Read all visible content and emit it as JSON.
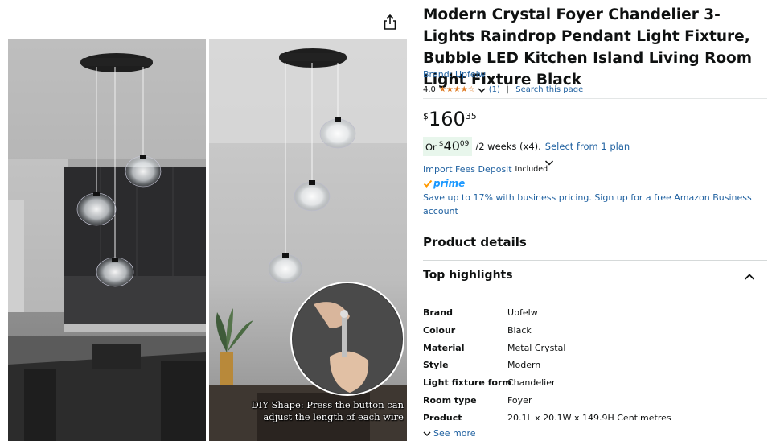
{
  "product": {
    "title": "Modern Crystal Foyer Chandelier 3-Lights Raindrop Pendant Light Fixture, Bubble LED Kitchen Island Living Room Light Fixture Black",
    "brand_link": "Brand: Upfelw",
    "rating_value": "4.0",
    "rating_stars": 4,
    "stars_display": "★★★★☆",
    "rating_count": "(1)",
    "separator": "|",
    "search_link": "Search this page"
  },
  "price": {
    "symbol": "$",
    "whole": "160",
    "fraction": "35"
  },
  "installment": {
    "prefix": "Or",
    "symbol": "$",
    "amount": "40",
    "fraction": "09",
    "terms": "/2 weeks (x4).",
    "plan_link": "Select from 1 plan"
  },
  "fees": {
    "link": "Import Fees Deposit",
    "included": "Included"
  },
  "prime": {
    "label": "prime",
    "accent": "#1a98ff"
  },
  "business": {
    "text": "Save up to 17% with business pricing. Sign up for a free Amazon Business account"
  },
  "details": {
    "heading": "Product details",
    "highlights_heading": "Top highlights",
    "specs": [
      {
        "key": "Brand",
        "value": "Upfelw"
      },
      {
        "key": "Colour",
        "value": "Black"
      },
      {
        "key": "Material",
        "value": "Metal Crystal"
      },
      {
        "key": "Style",
        "value": "Modern"
      },
      {
        "key": "Light fixture form",
        "value": "Chandelier"
      },
      {
        "key": "Room type",
        "value": "Foyer"
      },
      {
        "key": "Product",
        "value": "20.1L x 20.1W x 149.9H Centimetres"
      }
    ],
    "see_more": "See more"
  },
  "images": {
    "right_caption_line1": "DIY Shape: Press the button can",
    "right_caption_line2": "adjust the length of each wire"
  },
  "colors": {
    "link": "#2162a1",
    "star": "#de7921",
    "installment_bg": "#e8f6ec"
  },
  "icons": [
    "share-icon",
    "chevron-down-icon",
    "chevron-up-icon",
    "star-icon"
  ]
}
